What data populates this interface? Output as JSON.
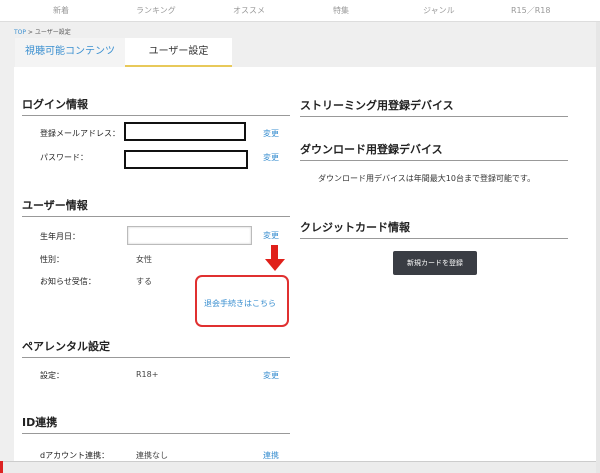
{
  "nav": [
    "新着",
    "ランキング",
    "オススメ",
    "特集",
    "ジャンル",
    "R15／R18"
  ],
  "breadcrumb": {
    "top": "TOP",
    "separator": " > ",
    "current": "ユーザー設定"
  },
  "tabs": {
    "contents": "視聴可能コンテンツ",
    "settings": "ユーザー設定"
  },
  "login": {
    "title": "ログイン情報",
    "email_label": "登録メールアドレス：",
    "email_value": "",
    "password_label": "パスワード：",
    "password_value": "",
    "change": "変更"
  },
  "user": {
    "title": "ユーザー情報",
    "birth_label": "生年月日：",
    "birth_value": "",
    "gender_label": "性別：",
    "gender_value": "女性",
    "notify_label": "お知らせ受信：",
    "notify_value": "する",
    "change": "変更",
    "withdraw_link": "退会手続きはこちら"
  },
  "parental": {
    "title": "ペアレンタル設定",
    "setting_label": "設定：",
    "setting_value": "R18+",
    "change": "変更"
  },
  "id_link": {
    "title": "ID連携",
    "account_label": "dアカウント連携：",
    "account_value": "連携なし",
    "change": "連携"
  },
  "streaming": {
    "title": "ストリーミング用登録デバイス"
  },
  "download": {
    "title": "ダウンロード用登録デバイス",
    "note": "ダウンロード用デバイスは年間最大10台まで登録可能です。"
  },
  "credit": {
    "title": "クレジットカード情報",
    "register_button": "新規カードを登録"
  },
  "colors": {
    "link": "#3a8fd0",
    "highlight_red": "#e03030",
    "tab_underline": "#e8c95a",
    "button_bg": "#3a3d44"
  }
}
